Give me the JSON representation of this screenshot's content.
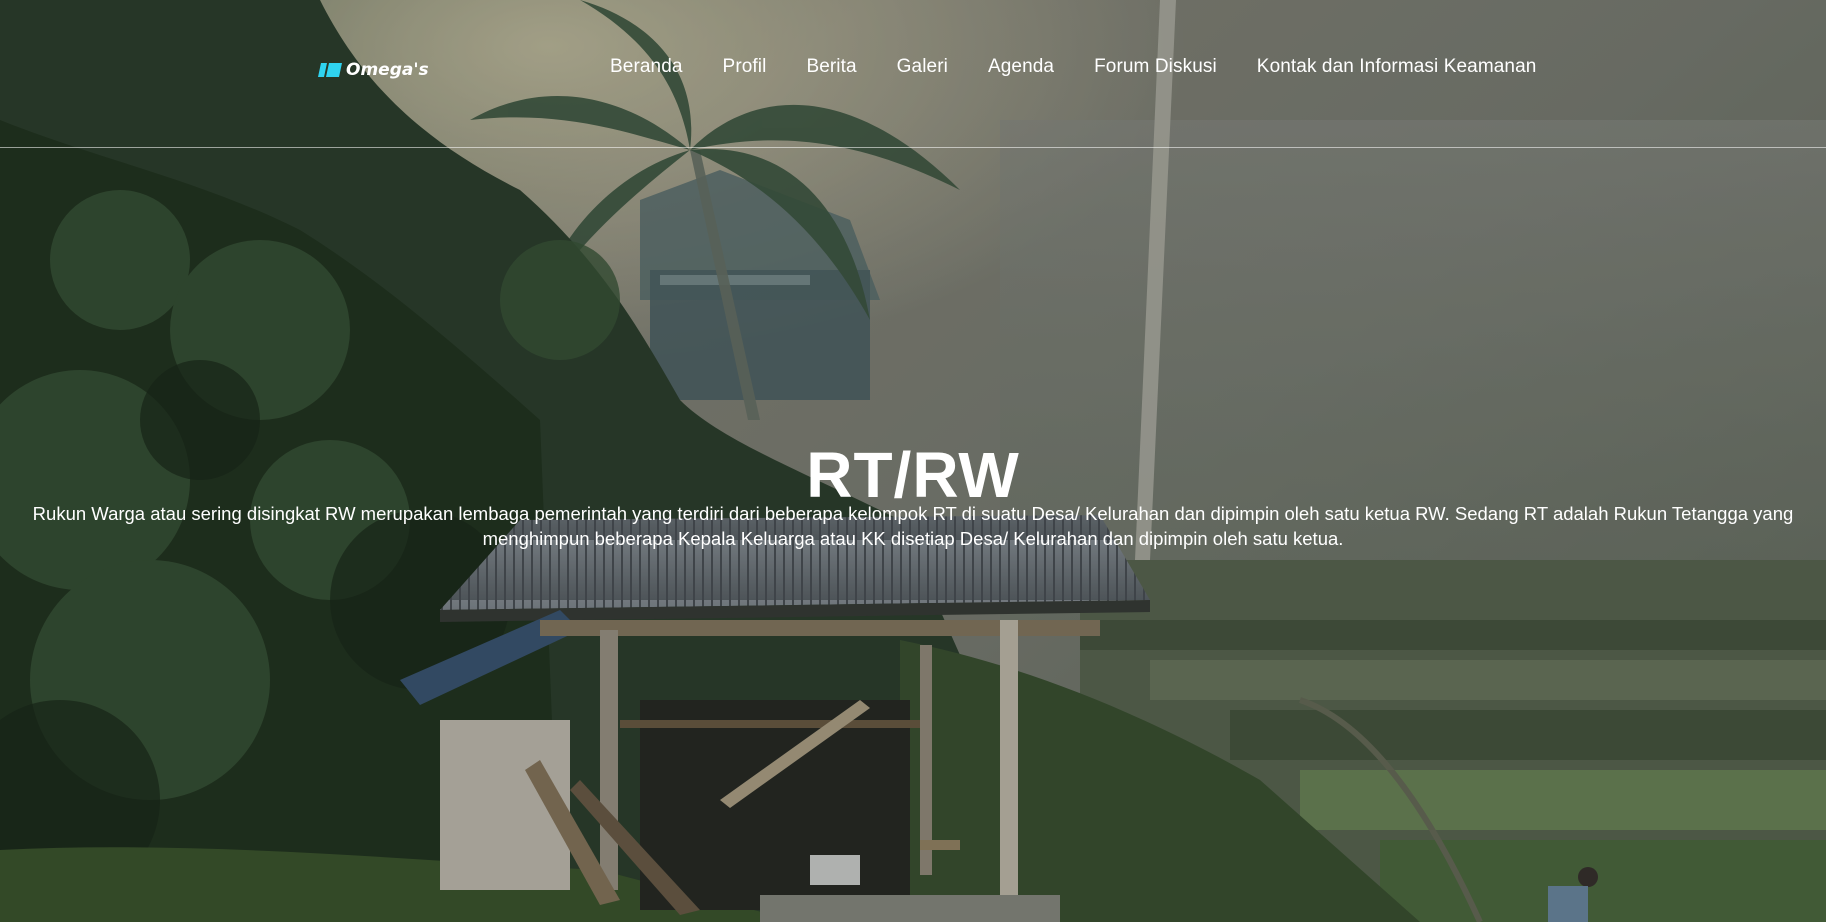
{
  "nav": {
    "brand": "Omega's",
    "brand_logo_icon": "omega-logo-icon",
    "items": [
      {
        "label": "Beranda"
      },
      {
        "label": "Profil"
      },
      {
        "label": "Berita"
      },
      {
        "label": "Galeri"
      },
      {
        "label": "Agenda"
      },
      {
        "label": "Forum Diskusi"
      },
      {
        "label": "Kontak dan Informasi Keamanan"
      }
    ]
  },
  "hero": {
    "title": "RT/RW",
    "description": "Rukun Warga atau sering disingkat RW merupakan lembaga pemerintah yang terdiri dari beberapa kelompok RT di suatu Desa/ Kelurahan dan dipimpin oleh satu ketua RW. Sedang RT adalah Rukun Tetangga yang menghimpun beberapa Kepala Keluarga atau KK disetiap Desa/ Kelurahan dan dipimpin oleh satu ketua."
  },
  "colors": {
    "text": "#ffffff",
    "brand_logo": "#2fd3f0"
  }
}
